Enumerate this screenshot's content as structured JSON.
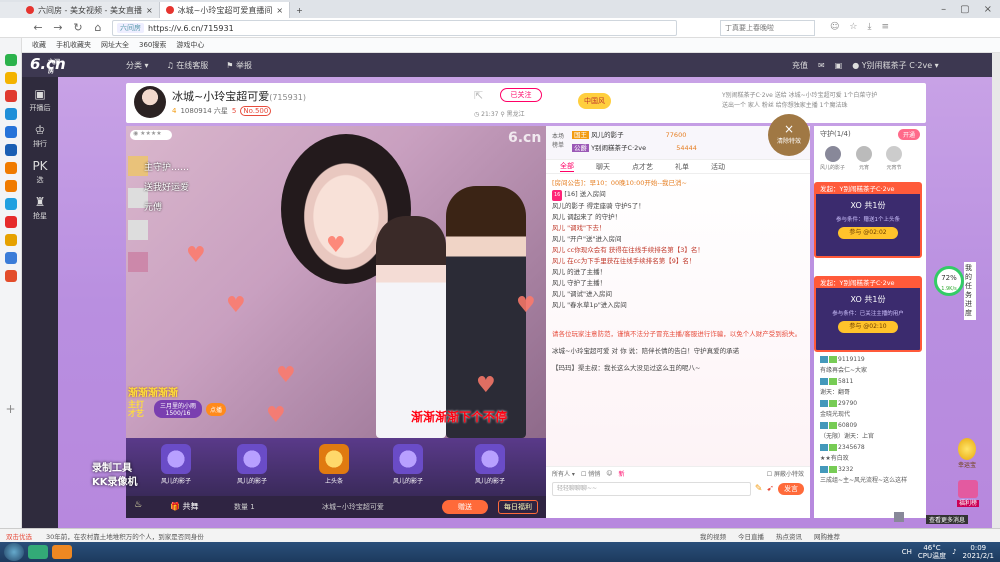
{
  "browser": {
    "tabs": [
      {
        "label": "六间房 - 美女视频 - 美女直播"
      },
      {
        "label": "冰城~小玲宝超可爱直播间"
      }
    ],
    "url": "https://v.6.cn/715931",
    "site_badge": "六间房",
    "search_placeholder": "丁真要上春晚啦"
  },
  "bookmarks": [
    "收藏",
    "手机收藏夹",
    "网址大全",
    "360搜索",
    "游戏中心"
  ],
  "site": {
    "logo": "6.cn",
    "logo_sub": "六间房",
    "nav": [
      "分类",
      "在线客服",
      "举报"
    ],
    "header_right": [
      "充值",
      "Y别闹糕茶子",
      "C·2ve"
    ],
    "sidenav": [
      {
        "icon": "▣",
        "label": "开播后"
      },
      {
        "icon": "♔",
        "label": "排行"
      },
      {
        "icon": "PK",
        "label": "选"
      },
      {
        "icon": "♜",
        "label": "抢星"
      }
    ]
  },
  "room": {
    "name": "冰城~小玲宝超可爱",
    "id": "(715931)",
    "level": "4",
    "fans": "1080914 六星",
    "gift_level": "5",
    "badge": "No.500",
    "follow_label": "已关注",
    "activity_badge": "中国风",
    "time": "21:37",
    "location": "黑龙江",
    "announce_1": "Y别闹糕茶子C·2ve 送给 冰城~小玲宝超可爱 1个白菜守护",
    "announce_2": "送出一个 家人 粉丝 给你想独家主播 1个魔法珠"
  },
  "video": {
    "watermark": "6.cn",
    "overlay_lines": [
      "主守护……",
      "送我好运爱",
      "元傅"
    ],
    "caption": "渐渐渐渐下个不停",
    "song_title": "渐渐渐渐渐",
    "talent_label": "主打才艺",
    "talent_name": "三月里的小雨",
    "talent_count": "1500/16",
    "talent_btn": "点播",
    "recorder_1": "录制工具",
    "recorder_2": "KK录像机"
  },
  "giftbar": {
    "slots": [
      "风儿的影子",
      "风儿的影子",
      "上头条",
      "风儿的影子",
      "风儿的影子"
    ]
  },
  "bottombar": {
    "gift_label": "共舞",
    "qty_label": "数量",
    "qty": "1",
    "target": "冰城~小玲宝超可爱",
    "send": "赠送",
    "daily": "每日福利"
  },
  "rank": {
    "title": "本场榜单",
    "rows": [
      {
        "badge": "国王",
        "name": "风儿的影子",
        "score": "77600"
      },
      {
        "badge": "公爵",
        "name": "Y别闹糕茶子C·2ve",
        "score": "54444"
      }
    ],
    "clear_btn": "清除特效"
  },
  "chat": {
    "tabs": [
      "全部",
      "聊天",
      "点才艺",
      "礼单",
      "活动"
    ],
    "messages": [
      "[房间公告]：早10：00晚10:00开始--我已消~",
      "[16] 送入房间",
      "风儿的影子 得定座骑 守护5了！",
      "风儿 调起来了 的守护！",
      "风儿 \"调戏\"下去！",
      "风儿 \"开户\"送\"进入房间",
      "风儿 cc你现众会有 获得在往线手续排名第【3】名！",
      "风儿 在cc为下手里获在往线手续排名第【9】名！",
      "风儿 的进了主播！",
      "风儿 守护了主播！",
      "风儿 \"调试\"进入房间",
      "风儿 \"春水草1p\"进入房间",
      "请各位玩家注意防范，谨慎不法分子冒充主播/客服进行诈骗，以免个人财产受到损失。",
      "冰城~小玲宝超可爱 对 你 说：陪伴长情的告白！守护真爱的承诺",
      "【玛玛】渠主叔：我长这么大没见过这么丑的呢八~"
    ],
    "to_label": "所有人",
    "private_label": "悄悄",
    "screen_label": "屏蔽小特效",
    "input_placeholder": "轻轻聊聊聊~~",
    "send": "发言",
    "new_label": "新"
  },
  "guard": {
    "title": "守护(1/4)",
    "btn": "开通",
    "avatars": [
      "风儿的影子",
      "元宵",
      "元宵节"
    ]
  },
  "redpacket": [
    {
      "header": "发起：Y别闹糕茶子C·2ve",
      "name": "XO 共1份",
      "cond": "参与条件：赠送1个上头条",
      "btn": "参与 @02:02"
    },
    {
      "header": "发起：Y别闹糕茶子C·2ve",
      "name": "XO 共1份",
      "cond": "参与条件：已关注主播的用户",
      "btn": "参与 @02:10"
    }
  ],
  "userlist": [
    {
      "name": "9119119",
      "note": "有缘再会仁~大家"
    },
    {
      "name": "5811",
      "note": "谢天：翻哥"
    },
    {
      "name": "29790",
      "note": "金晓光现代"
    },
    {
      "name": "60809",
      "note": "（无限）谢天：上官"
    },
    {
      "name": "2345678",
      "note": "★★有白玫"
    },
    {
      "name": "3232",
      "note": "三成组~主~风光流程~这么这样"
    }
  ],
  "widgets": {
    "progress": "72%",
    "progress_speed": "1.9K/s",
    "progress_label": "我的任务进度",
    "treasure": "幸运宝",
    "welfare": "福利榜",
    "reply_label": "查看更多消息"
  },
  "statusbar": {
    "left": "双击优选",
    "tip": "30年前，在农村靠土地堆积万的个人，到家是否同身份",
    "items": [
      "我的视频",
      "今日直播",
      "热点资讯",
      "网购推荐"
    ]
  },
  "taskbar": {
    "time": "0:09",
    "date": "2021/2/1",
    "temp": "46°C",
    "temp_label": "CPU温度",
    "lang": "CH"
  }
}
